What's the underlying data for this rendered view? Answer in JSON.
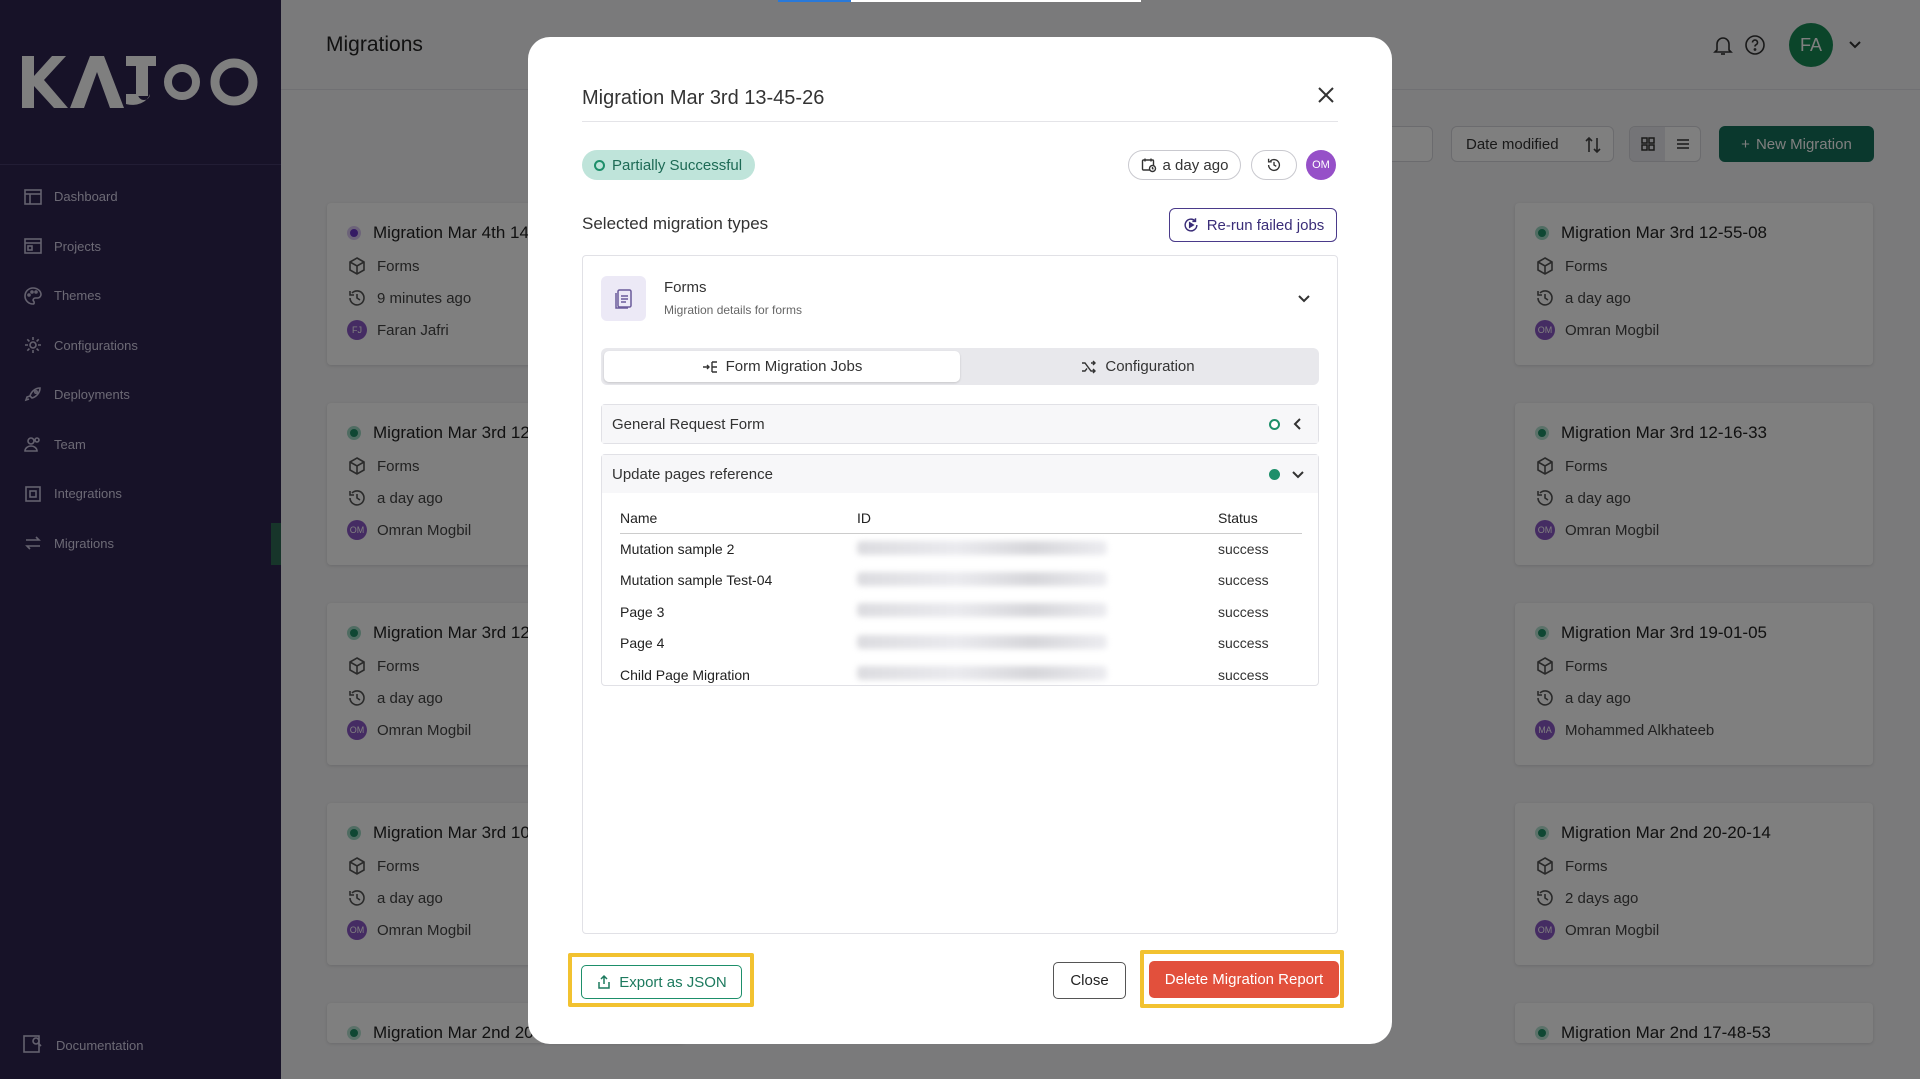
{
  "app": {
    "logo_text": "KAJOO"
  },
  "sidebar": {
    "items": [
      {
        "label": "Dashboard",
        "icon": "dashboard-icon"
      },
      {
        "label": "Projects",
        "icon": "projects-icon"
      },
      {
        "label": "Themes",
        "icon": "palette-icon"
      },
      {
        "label": "Configurations",
        "icon": "gear-icon"
      },
      {
        "label": "Deployments",
        "icon": "rocket-icon"
      },
      {
        "label": "Team",
        "icon": "team-icon"
      },
      {
        "label": "Integrations",
        "icon": "integrations-icon"
      },
      {
        "label": "Migrations",
        "icon": "migrations-icon",
        "active": true
      }
    ],
    "documentation": "Documentation"
  },
  "header": {
    "title": "Migrations",
    "user_initials": "FA",
    "avatar_color": "#178a55"
  },
  "toolbar": {
    "sort_label": "Date modified",
    "new_button": "New Migration"
  },
  "cards": {
    "left": [
      {
        "title": "Migration Mar 4th 14",
        "type": "Forms",
        "time": "9 minutes ago",
        "user": "Faran Jafri",
        "initials": "FJ"
      },
      {
        "title": "Migration Mar 3rd 12",
        "type": "Forms",
        "time": "a day ago",
        "user": "Omran Mogbil",
        "initials": "OM"
      },
      {
        "title": "Migration Mar 3rd 12",
        "type": "Forms",
        "time": "a day ago",
        "user": "Omran Mogbil",
        "initials": "OM"
      },
      {
        "title": "Migration Mar 3rd 10",
        "type": "Forms",
        "time": "a day ago",
        "user": "Omran Mogbil",
        "initials": "OM"
      },
      {
        "title": "Migration Mar 2nd 20"
      }
    ],
    "right": [
      {
        "title": "Migration Mar 3rd 12-55-08",
        "type": "Forms",
        "time": "a day ago",
        "user": "Omran Mogbil",
        "initials": "OM"
      },
      {
        "title": "Migration Mar 3rd 12-16-33",
        "type": "Forms",
        "time": "a day ago",
        "user": "Omran Mogbil",
        "initials": "OM"
      },
      {
        "title": "Migration Mar 3rd 19-01-05",
        "type": "Forms",
        "time": "a day ago",
        "user": "Mohammed Alkhateeb",
        "initials": "MA"
      },
      {
        "title": "Migration Mar 2nd 20-20-14",
        "type": "Forms",
        "time": "2 days ago",
        "user": "Omran Mogbil",
        "initials": "OM"
      },
      {
        "title": "Migration Mar 2nd 17-48-53"
      }
    ]
  },
  "modal": {
    "title": "Migration Mar 3rd 13-45-26",
    "status": "Partially Successful",
    "status_color": "#1d6a55",
    "time": "a day ago",
    "user_initials": "OM",
    "selected_label": "Selected migration types",
    "rerun_button": "Re-run failed jobs",
    "forms": {
      "title": "Forms",
      "subtitle": "Migration details for forms"
    },
    "tabs": [
      "Form Migration Jobs",
      "Configuration"
    ],
    "accordions": [
      {
        "label": "General Request Form"
      },
      {
        "label": "Update pages reference"
      }
    ],
    "table": {
      "headers": [
        "Name",
        "ID",
        "Status"
      ],
      "rows": [
        {
          "name": "Mutation sample 2",
          "status": "success"
        },
        {
          "name": "Mutation sample Test-04",
          "status": "success"
        },
        {
          "name": "Page 3",
          "status": "success"
        },
        {
          "name": "Page 4",
          "status": "success"
        },
        {
          "name": "Child Page Migration",
          "status": "success"
        }
      ]
    },
    "export_button": "Export as JSON",
    "close_button": "Close",
    "delete_button": "Delete Migration Report",
    "delete_color": "#e2503c",
    "highlight_color": "#f2c230"
  }
}
